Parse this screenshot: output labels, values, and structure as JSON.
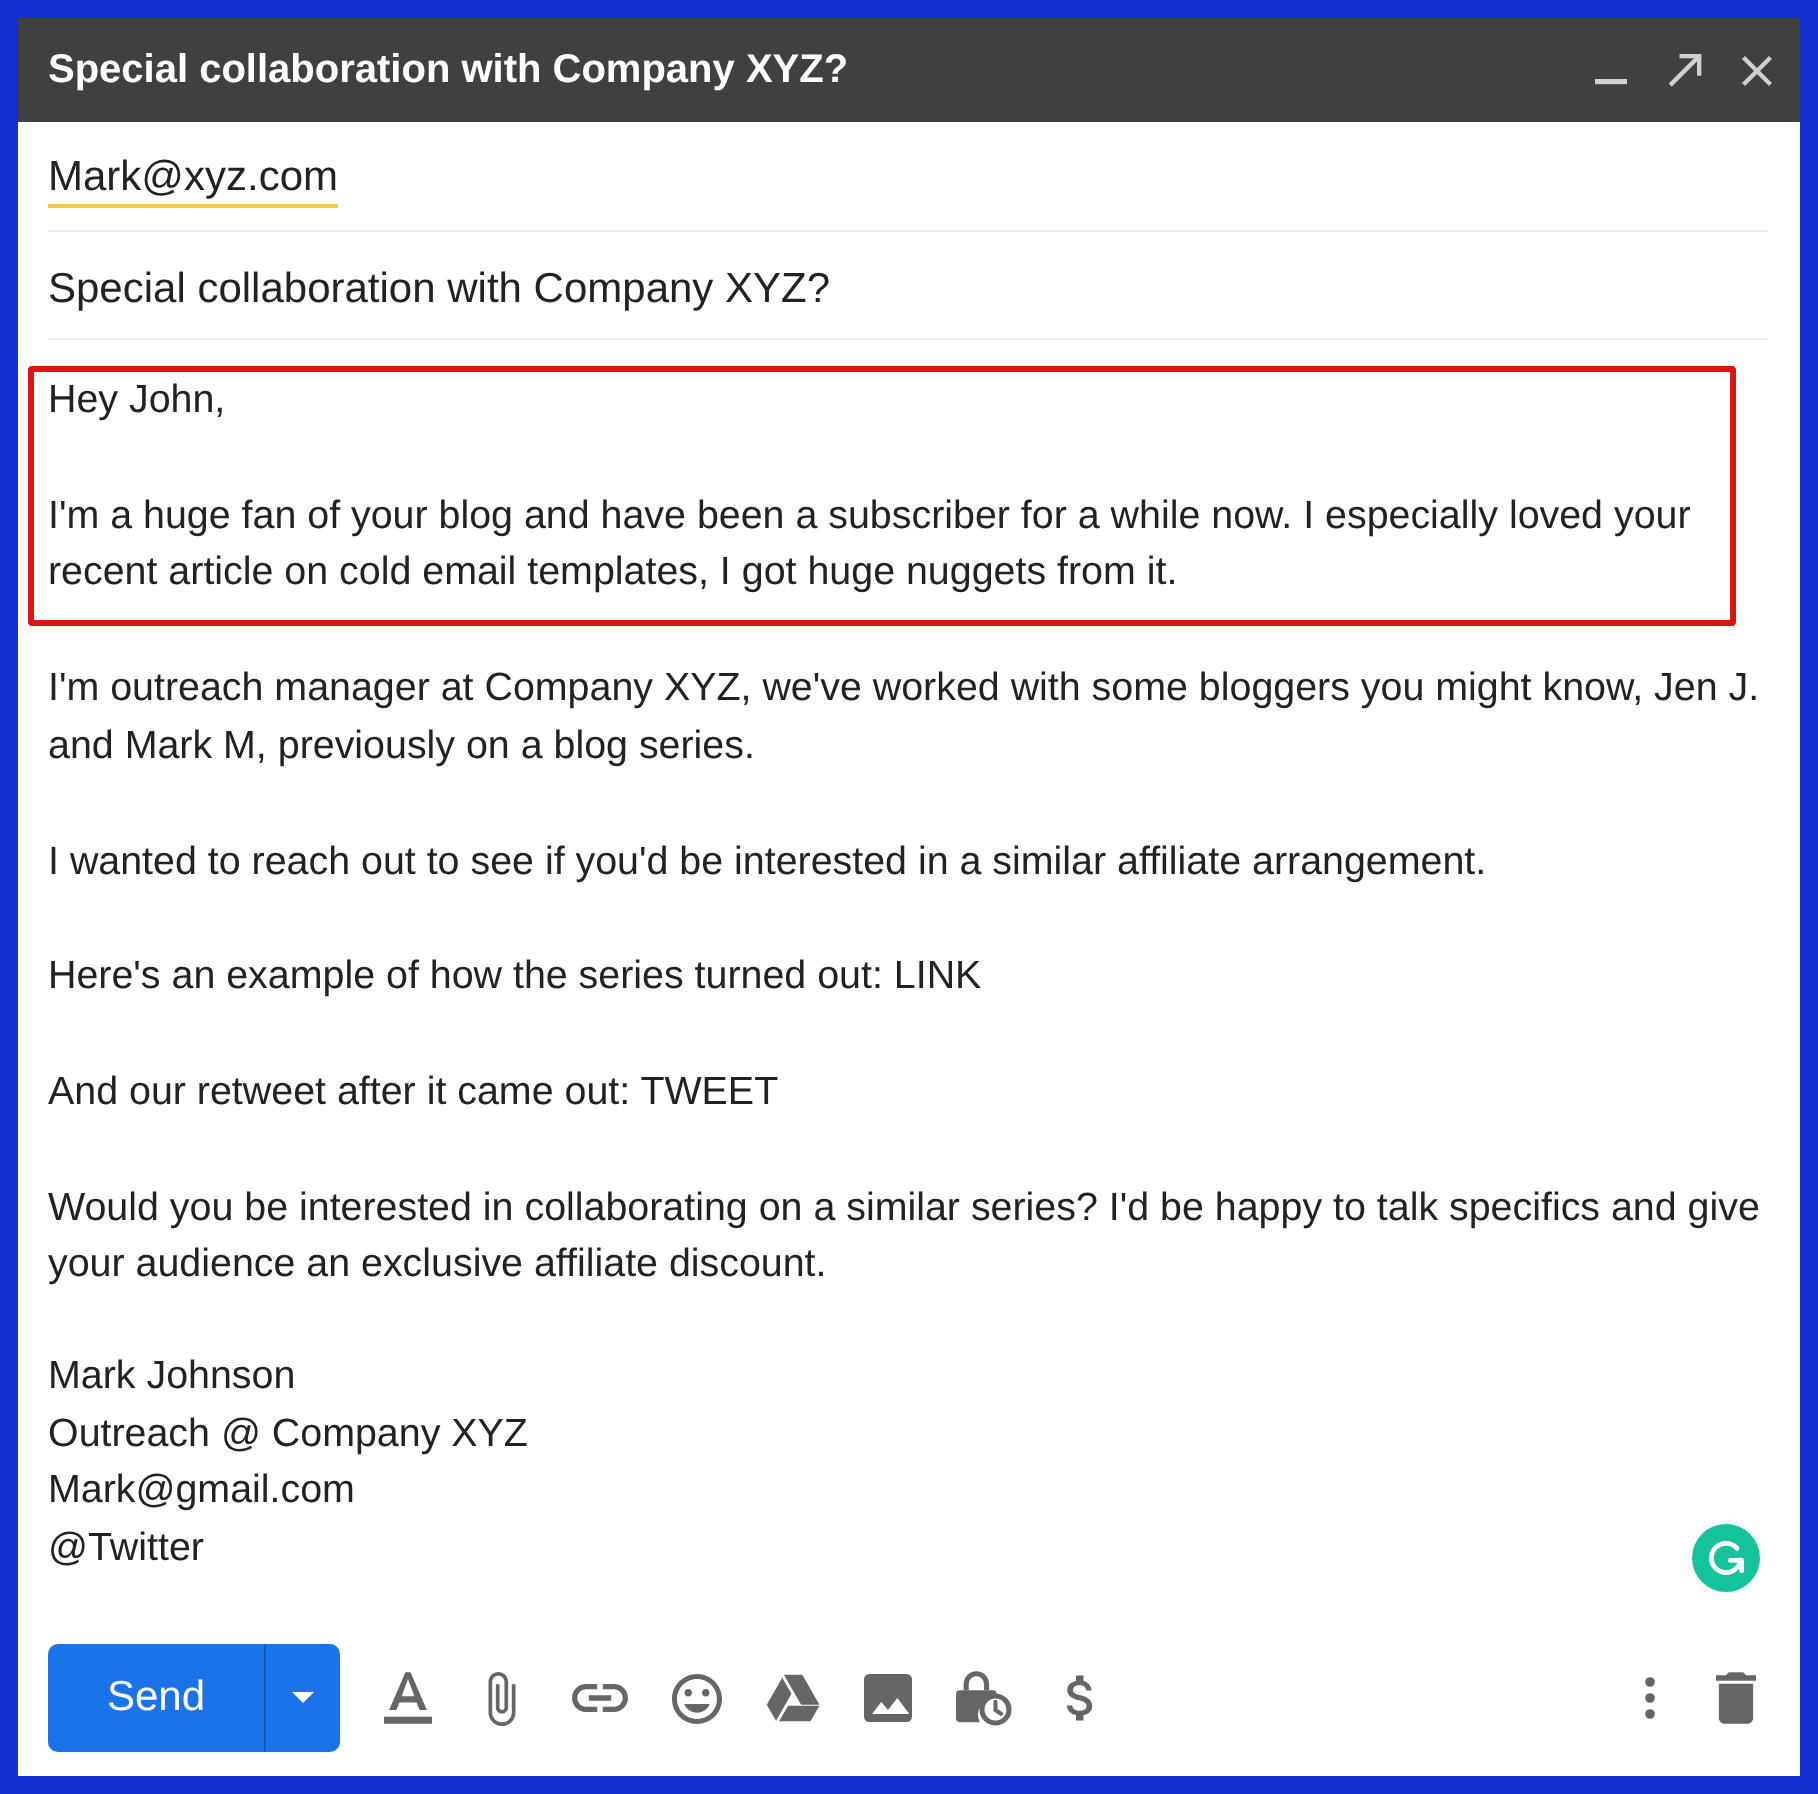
{
  "window": {
    "title": "Special collaboration with Company XYZ?"
  },
  "to": {
    "recipient": "Mark@xyz.com"
  },
  "subject": {
    "value": "Special collaboration with Company XYZ?"
  },
  "body": {
    "highlight_box": [
      "Hey John,",
      "I'm a huge fan of your blog and have been a subscriber for a while now. I especially loved your recent article on cold email templates, I got huge nuggets from it."
    ],
    "paragraphs": [
      "I'm outreach manager at Company XYZ, we've worked with some bloggers you might know, Jen J. and Mark M, previously on a blog series.",
      "I wanted to reach out to see if you'd be interested in a similar affiliate arrangement.",
      "Here's an example of how the series turned out: LINK",
      "And our retweet after it came out: TWEET",
      "Would you be interested in collaborating on a similar series? I'd be happy to talk specifics and give your audience an exclusive affiliate discount."
    ]
  },
  "signature": [
    "Mark Johnson",
    "Outreach @ Company XYZ",
    "Mark@gmail.com",
    "@Twitter"
  ],
  "toolbar": {
    "send_label": "Send"
  }
}
